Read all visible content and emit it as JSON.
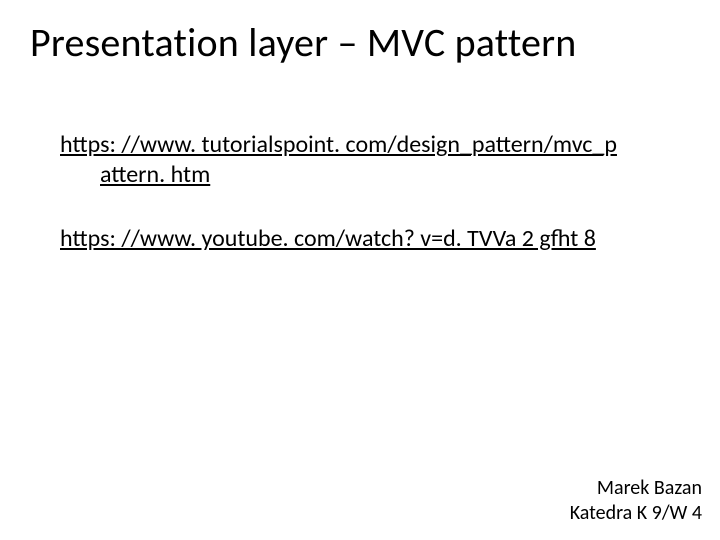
{
  "title": "Presentation layer – MVC pattern",
  "links": {
    "first_line1": "https: //www. tutorialspoint. com/design_pattern/mvc_p",
    "first_line2": "attern. htm",
    "second": "https: //www. youtube. com/watch? v=d. TVVa 2 gfht 8"
  },
  "footer": {
    "author": "Marek Bazan",
    "dept": "Katedra K 9/W 4"
  }
}
